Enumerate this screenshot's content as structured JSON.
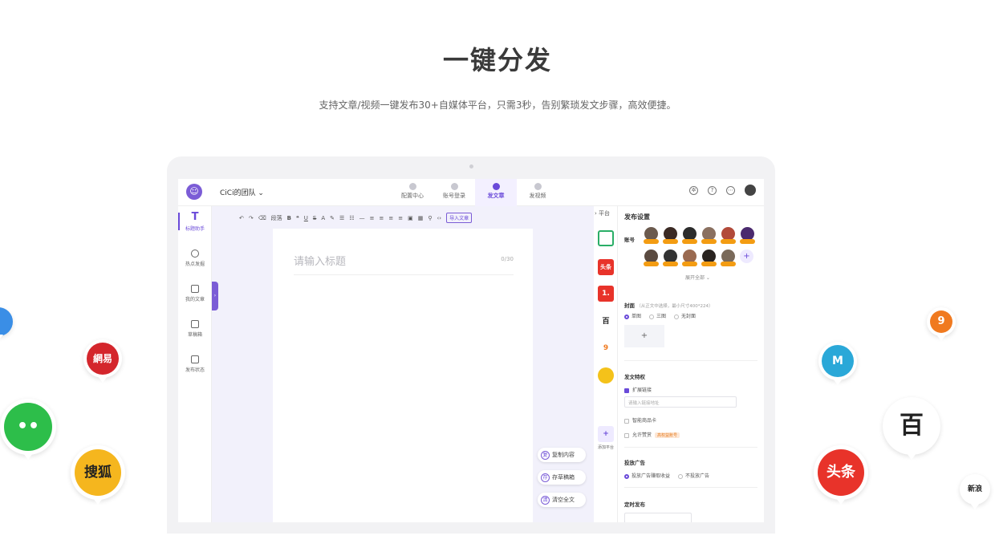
{
  "hero": {
    "title": "一键分发",
    "subtitle": "支持文章/视频一键发布30+自媒体平台，只需3秒，告别繁琐发文步骤，高效便捷。"
  },
  "app": {
    "team": "CiCi的团队 ⌄",
    "tabs": [
      "配置中心",
      "账号登录",
      "发文章",
      "发视频"
    ],
    "active_tab": "发文章",
    "left_nav": [
      "标题助手",
      "热点发掘",
      "我的文章",
      "草稿箱",
      "发布状态"
    ],
    "toolbar_paragraph": "段落",
    "import_label": "导入文章",
    "editor": {
      "title_placeholder": "请输入标题",
      "title_count": "0/30"
    },
    "side_buttons": [
      "复制内容",
      "存草稿箱",
      "清空全文"
    ],
    "side_button_icons": [
      "复",
      "存",
      "清"
    ],
    "platforms_header": "平台",
    "platforms": [
      {
        "name": "wechat-platform",
        "label": "",
        "color": "#2aae67"
      },
      {
        "name": "toutiao-platform",
        "label": "头条",
        "color": "#e8332a"
      },
      {
        "name": "yidian-platform",
        "label": "1.",
        "color": "#e8332a"
      },
      {
        "name": "baijiahao-platform",
        "label": "百",
        "color": "#222222"
      },
      {
        "name": "sohu-platform",
        "label": "9",
        "color": "#f07a20"
      },
      {
        "name": "qq-platform",
        "label": "",
        "color": "#f4c21a"
      }
    ],
    "add_platform_label": "添加平台",
    "settings": {
      "title": "发布设置",
      "account_label": "账号",
      "expand_all": "展开全部 ⌄",
      "cover_label": "封面",
      "cover_hint": "（从正文中选择，最小尺寸400*224）",
      "cover_options": [
        "单图",
        "三图",
        "无封面"
      ],
      "perk_label": "发文特权",
      "extend_link": "扩展链接",
      "link_placeholder": "请输入链接地址",
      "smart_card": "智能商品卡",
      "allow_tip": "允许赞赏",
      "tip_badge": "高权益账号",
      "ad_label": "投放广告",
      "ad_options": [
        "投放广告赚取收益",
        "不投放广告"
      ],
      "schedule_label": "定时发布"
    }
  },
  "colors": {
    "accent": "#6a4ad9",
    "title": "#3a3a3a"
  }
}
